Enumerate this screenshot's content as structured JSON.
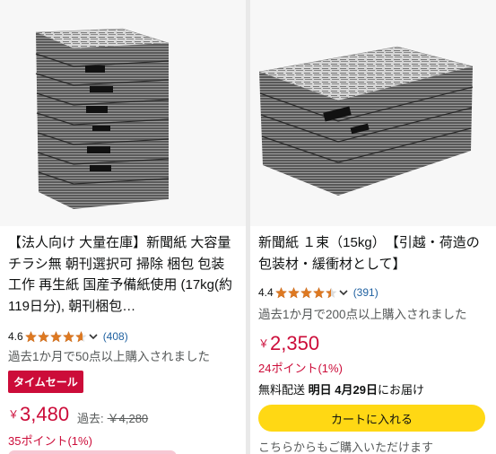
{
  "products": [
    {
      "title": "【法人向け 大量在庫】新聞紙 大容量 チラシ無 朝刊選択可 掃除 梱包 包装 工作 再生紙 国産予備紙使用 (17kg(約119日分), 朝刊梱包…",
      "rating": "4.6",
      "rating_stars": 4.6,
      "rating_count": "(408)",
      "bought": "過去1か月で50点以上購入されました",
      "badge": "タイムセール",
      "currency": "￥",
      "price": "3,480",
      "was_label": "過去:",
      "was_price": "￥4,280",
      "points": "35ポイント(1%)"
    },
    {
      "title": "新聞紙 １束（15kg）　【引越・荷造の包装材・緩衝材として】",
      "rating": "4.4",
      "rating_stars": 4.4,
      "rating_count": "(391)",
      "bought": "過去1か月で200点以上購入されました",
      "currency": "￥",
      "price": "2,350",
      "points": "24ポイント(1%)",
      "delivery_prefix": "無料配送",
      "delivery_date": "明日 4月29日",
      "delivery_suffix": "にお届け",
      "cart_button": "カートに入れる",
      "other_sellers": "こちらからもご購入いただけます"
    }
  ],
  "colors": {
    "price": "#cc0c39",
    "badge": "#cc0c39",
    "star": "#de7921",
    "link": "#2162a1",
    "cart": "#ffd814"
  }
}
